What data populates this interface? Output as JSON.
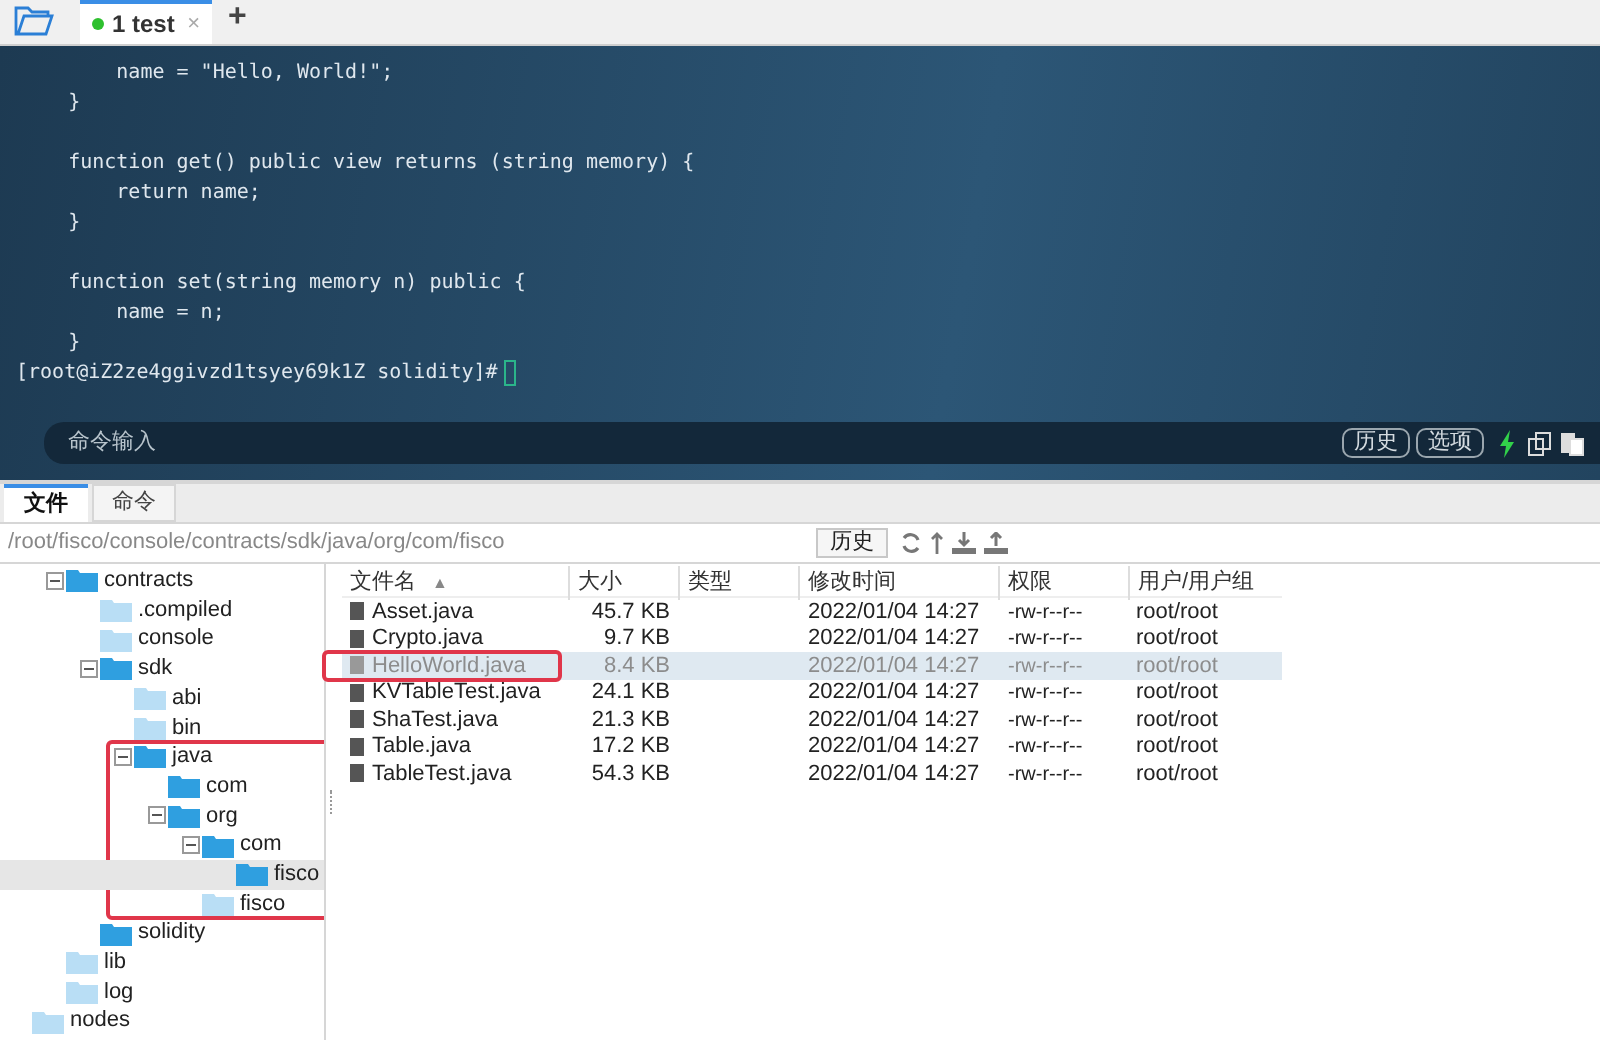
{
  "session_tabs": [
    {
      "label": "1 test",
      "connected": true,
      "selected": true,
      "close": "×"
    }
  ],
  "new_tab": "+",
  "terminal": {
    "blocks": [
      [
        "        name = \"Hello, World!\";",
        "    }"
      ],
      [
        "    function get() public view returns (string memory) {",
        "        return name;",
        "    }"
      ],
      [
        "    function set(string memory n) public {",
        "        name = n;",
        "    }"
      ]
    ],
    "prompt": "[root@iZ2ze4ggivzd1tsyey69k1Z solidity]#"
  },
  "command_bar": {
    "placeholder": "命令输入",
    "buttons": [
      "历史",
      "选项"
    ]
  },
  "panel_tabs": [
    {
      "label": "文件",
      "selected": true
    },
    {
      "label": "命令",
      "selected": false
    }
  ],
  "path_bar": {
    "path": "/root/fisco/console/contracts/sdk/java/org/com/fisco",
    "history_button": "历史"
  },
  "tree": {
    "children": [
      {
        "label": "contracts",
        "expanded": true,
        "children": [
          {
            "label": ".compiled"
          },
          {
            "label": "console"
          },
          {
            "label": "sdk",
            "expanded": true,
            "children": [
              {
                "label": "abi"
              },
              {
                "label": "bin"
              },
              {
                "label": "java",
                "expanded": true,
                "annotated": true,
                "children": [
                  {
                    "label": "com",
                    "filled": true
                  },
                  {
                    "label": "org",
                    "expanded": true,
                    "children": [
                      {
                        "label": "com",
                        "expanded": true,
                        "children": [
                          {
                            "label": "fisco",
                            "selected": true,
                            "filled": true
                          }
                        ]
                      },
                      {
                        "label": "fisco"
                      }
                    ]
                  }
                ]
              }
            ]
          },
          {
            "label": "solidity",
            "filled": true
          }
        ]
      },
      {
        "label": "lib"
      },
      {
        "label": "log"
      }
    ],
    "after": [
      {
        "label": "nodes"
      }
    ]
  },
  "table": {
    "columns": [
      "文件名",
      "大小",
      "类型",
      "修改时间",
      "权限",
      "用户/用户组"
    ],
    "sort_arrow": "▲",
    "rows": [
      {
        "cells": [
          "Asset.java",
          "45.7 KB",
          "",
          "2022/01/04 14:27",
          "-rw-r--r--",
          "root/root"
        ],
        "selected": false,
        "annotated": false
      },
      {
        "cells": [
          "Crypto.java",
          "9.7 KB",
          "",
          "2022/01/04 14:27",
          "-rw-r--r--",
          "root/root"
        ],
        "selected": false,
        "annotated": false
      },
      {
        "cells": [
          "HelloWorld.java",
          "8.4 KB",
          "",
          "2022/01/04 14:27",
          "-rw-r--r--",
          "root/root"
        ],
        "selected": true,
        "annotated": true
      },
      {
        "cells": [
          "KVTableTest.java",
          "24.1 KB",
          "",
          "2022/01/04 14:27",
          "-rw-r--r--",
          "root/root"
        ],
        "selected": false,
        "annotated": false
      },
      {
        "cells": [
          "ShaTest.java",
          "21.3 KB",
          "",
          "2022/01/04 14:27",
          "-rw-r--r--",
          "root/root"
        ],
        "selected": false,
        "annotated": false
      },
      {
        "cells": [
          "Table.java",
          "17.2 KB",
          "",
          "2022/01/04 14:27",
          "-rw-r--r--",
          "root/root"
        ],
        "selected": false,
        "annotated": false
      },
      {
        "cells": [
          "TableTest.java",
          "54.3 KB",
          "",
          "2022/01/04 14:27",
          "-rw-r--r--",
          "root/root"
        ],
        "selected": false,
        "annotated": false
      }
    ]
  }
}
